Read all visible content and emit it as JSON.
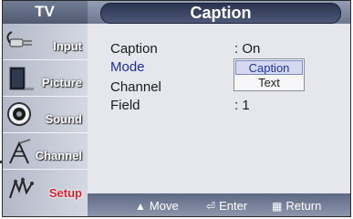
{
  "header": {
    "tv_label": "TV",
    "title": "Caption"
  },
  "sidebar": {
    "items": [
      {
        "label": "Input",
        "icon": "input-plug-icon",
        "active": false
      },
      {
        "label": "Picture",
        "icon": "picture-icon",
        "active": false
      },
      {
        "label": "Sound",
        "icon": "sound-speaker-icon",
        "active": false
      },
      {
        "label": "Channel",
        "icon": "channel-antenna-icon",
        "active": false
      },
      {
        "label": "Setup",
        "icon": "setup-icon",
        "active": true
      }
    ]
  },
  "menu": {
    "rows": [
      {
        "label": "Caption",
        "value": ": On"
      },
      {
        "label": "Mode",
        "value": ""
      },
      {
        "label": "Channel",
        "value": ""
      },
      {
        "label": "Field",
        "value": ": 1"
      }
    ],
    "dropdown": {
      "options": [
        "Caption",
        "Text"
      ],
      "selected": "Caption"
    }
  },
  "footer": {
    "move": "Move",
    "enter": "Enter",
    "return": "Return"
  },
  "colors": {
    "accent_active": "#d81e2c",
    "highlight_text": "#1b2f9a",
    "title_pill": "#2b3450"
  }
}
